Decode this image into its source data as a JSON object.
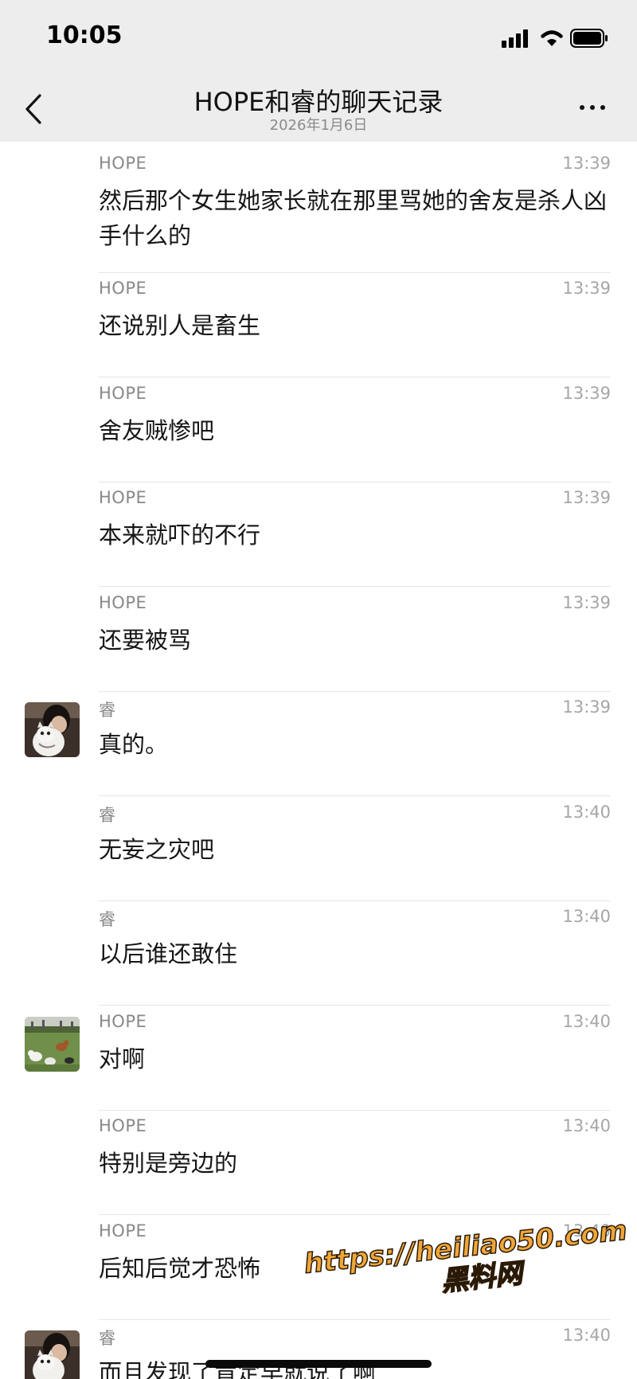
{
  "status_bar": {
    "time": "10:05"
  },
  "header": {
    "title": "HOPE和睿的聊天记录",
    "date": "2026年1月6日",
    "back_icon": "chevron-left-icon",
    "more_icon": "more-dots-icon"
  },
  "messages": [
    {
      "sender": "HOPE",
      "time": "13:39",
      "text": "然后那个女生她家长就在那里骂她的舍友是杀人凶手什么的",
      "avatar": ""
    },
    {
      "sender": "HOPE",
      "time": "13:39",
      "text": "还说别人是畜生",
      "avatar": ""
    },
    {
      "sender": "HOPE",
      "time": "13:39",
      "text": "舍友贼惨吧",
      "avatar": ""
    },
    {
      "sender": "HOPE",
      "time": "13:39",
      "text": "本来就吓的不行",
      "avatar": ""
    },
    {
      "sender": "HOPE",
      "time": "13:39",
      "text": "还要被骂",
      "avatar": ""
    },
    {
      "sender": "睿",
      "time": "13:39",
      "text": "真的。",
      "avatar": "person-with-cat"
    },
    {
      "sender": "睿",
      "time": "13:40",
      "text": "无妄之灾吧",
      "avatar": ""
    },
    {
      "sender": "睿",
      "time": "13:40",
      "text": "以后谁还敢住",
      "avatar": ""
    },
    {
      "sender": "HOPE",
      "time": "13:40",
      "text": "对啊",
      "avatar": "dogs-on-lawn"
    },
    {
      "sender": "HOPE",
      "time": "13:40",
      "text": "特别是旁边的",
      "avatar": ""
    },
    {
      "sender": "HOPE",
      "time": "13:40",
      "text": "后知后觉才恐怖",
      "avatar": ""
    },
    {
      "sender": "睿",
      "time": "13:40",
      "text": "而且发现了肯定早就说了啊",
      "avatar": "person-with-cat"
    }
  ],
  "watermark": {
    "url": "https://heiliao50.com",
    "name": "黑料网"
  },
  "colors": {
    "header_bg": "#ededed",
    "page_bg": "#ffffff",
    "sender": "#888888",
    "time": "#a6a6a6",
    "divider": "#e6e6e6",
    "watermark": "#f0a63a"
  }
}
